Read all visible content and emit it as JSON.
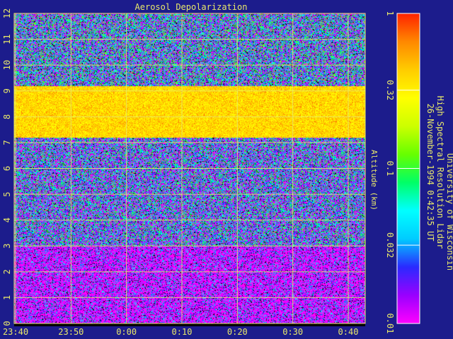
{
  "colors": {
    "background": "#1c1c8c",
    "text": "#e8e86a",
    "grid": "#e8e86a"
  },
  "chart_data": {
    "type": "heatmap",
    "title": "Aerosol Depolarization",
    "ylabel": "Altitude (km)",
    "xlabel": "",
    "x_ticks": [
      "23:40",
      "23:50",
      "0:00",
      "0:10",
      "0:20",
      "0:30",
      "0:40"
    ],
    "y_ticks": [
      "0",
      "1",
      "2",
      "3",
      "4",
      "5",
      "6",
      "7",
      "8",
      "9",
      "10",
      "11",
      "12"
    ],
    "ylim": [
      0,
      12
    ],
    "grid": true,
    "colorbar": {
      "scale": "log",
      "range": [
        0.01,
        1
      ],
      "ticks": [
        "1",
        "0.32",
        "0.1",
        "0.032",
        "0.01"
      ],
      "tick_values": [
        1,
        0.32,
        0.1,
        0.032,
        0.01
      ],
      "colors_low_to_high": [
        "#ff00ff",
        "#9900ff",
        "#2a2aff",
        "#00ccff",
        "#00ffff",
        "#00ff66",
        "#66ff00",
        "#ccff00",
        "#ffff00",
        "#ffcc00",
        "#ff8800",
        "#ff2200"
      ]
    },
    "description_lines": [
      "University of Wisconsin",
      "High Spectral Resolution Lidar",
      "26-November-1994  0:42:35 UT"
    ],
    "layers": [
      {
        "altitude_km": [
          0,
          3
        ],
        "depolarization": 0.012
      },
      {
        "altitude_km": [
          3,
          7.2
        ],
        "depolarization": 0.03
      },
      {
        "altitude_km": [
          7.2,
          9.2
        ],
        "depolarization": 0.35
      },
      {
        "altitude_km": [
          9.2,
          12
        ],
        "depolarization": 0.035
      }
    ]
  }
}
